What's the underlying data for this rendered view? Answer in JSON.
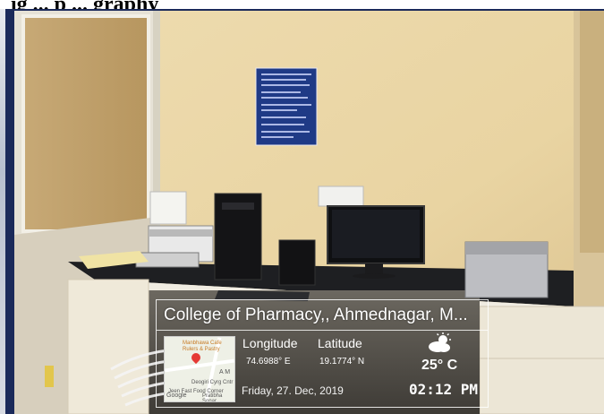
{
  "page": {
    "header_fragment": "ig ... p ... graphy"
  },
  "overlay": {
    "location_title": "College of Pharmacy,, Ahmednagar, M...",
    "longitude_label": "Longitude",
    "latitude_label": "Latitude",
    "longitude_value": "74.6988° E",
    "latitude_value": "19.1774° N",
    "temperature": "25° C",
    "date": "Friday, 27. Dec, 2019",
    "time": "02:12 PM",
    "weather_icon": "partly-cloudy-icon"
  },
  "map": {
    "place1": "Manbhawa Cafe Rulers & Pastry",
    "place2": "Deogiri Cyrg Cntr",
    "place3": "Jeen Fast Food Corner",
    "place4": "Pratibha Sonar",
    "provider": "Google",
    "road_label": "A M"
  },
  "colors": {
    "frame": "#1b2a5a",
    "wall": "#e8d3a4",
    "desk": "#1e1f22"
  }
}
